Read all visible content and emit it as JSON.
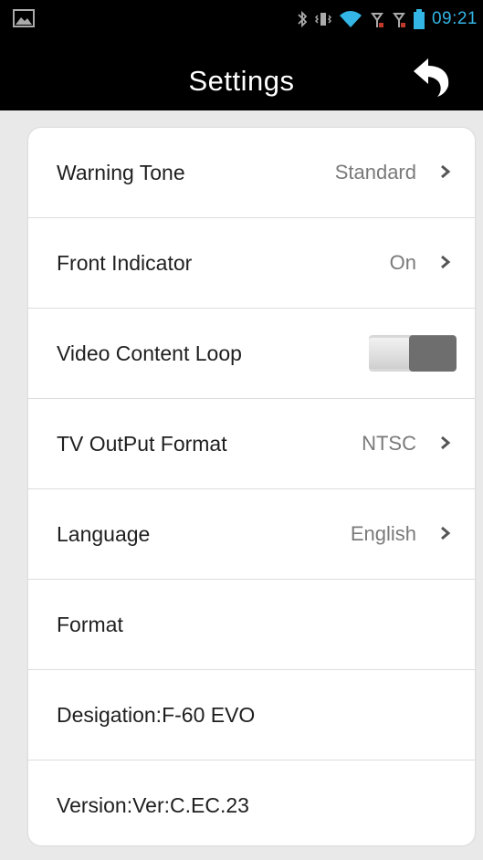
{
  "status_bar": {
    "time": "09:21",
    "icons": [
      "image-icon",
      "bluetooth-icon",
      "vibrate-icon",
      "wifi-icon",
      "signal-1-icon",
      "signal-2-icon",
      "battery-icon"
    ]
  },
  "header": {
    "title": "Settings",
    "back_icon": "back-arrow-icon"
  },
  "settings": {
    "warning_tone": {
      "label": "Warning Tone",
      "value": "Standard"
    },
    "front_indicator": {
      "label": "Front Indicator",
      "value": "On"
    },
    "video_content_loop": {
      "label": "Video Content Loop",
      "toggle": "on"
    },
    "tv_output_format": {
      "label": "TV OutPut Format",
      "value": "NTSC"
    },
    "language": {
      "label": "Language",
      "value": "English"
    },
    "format": {
      "label": "Format"
    },
    "designation": {
      "label": "Desigation:F-60 EVO"
    },
    "version": {
      "label": "Version:Ver:C.EC.23"
    }
  },
  "colors": {
    "status_accent": "#33b5e5",
    "header_bg": "#000000",
    "page_bg": "#e9e9e9",
    "card_bg": "#ffffff",
    "toggle_on": "#6e6e6e"
  }
}
